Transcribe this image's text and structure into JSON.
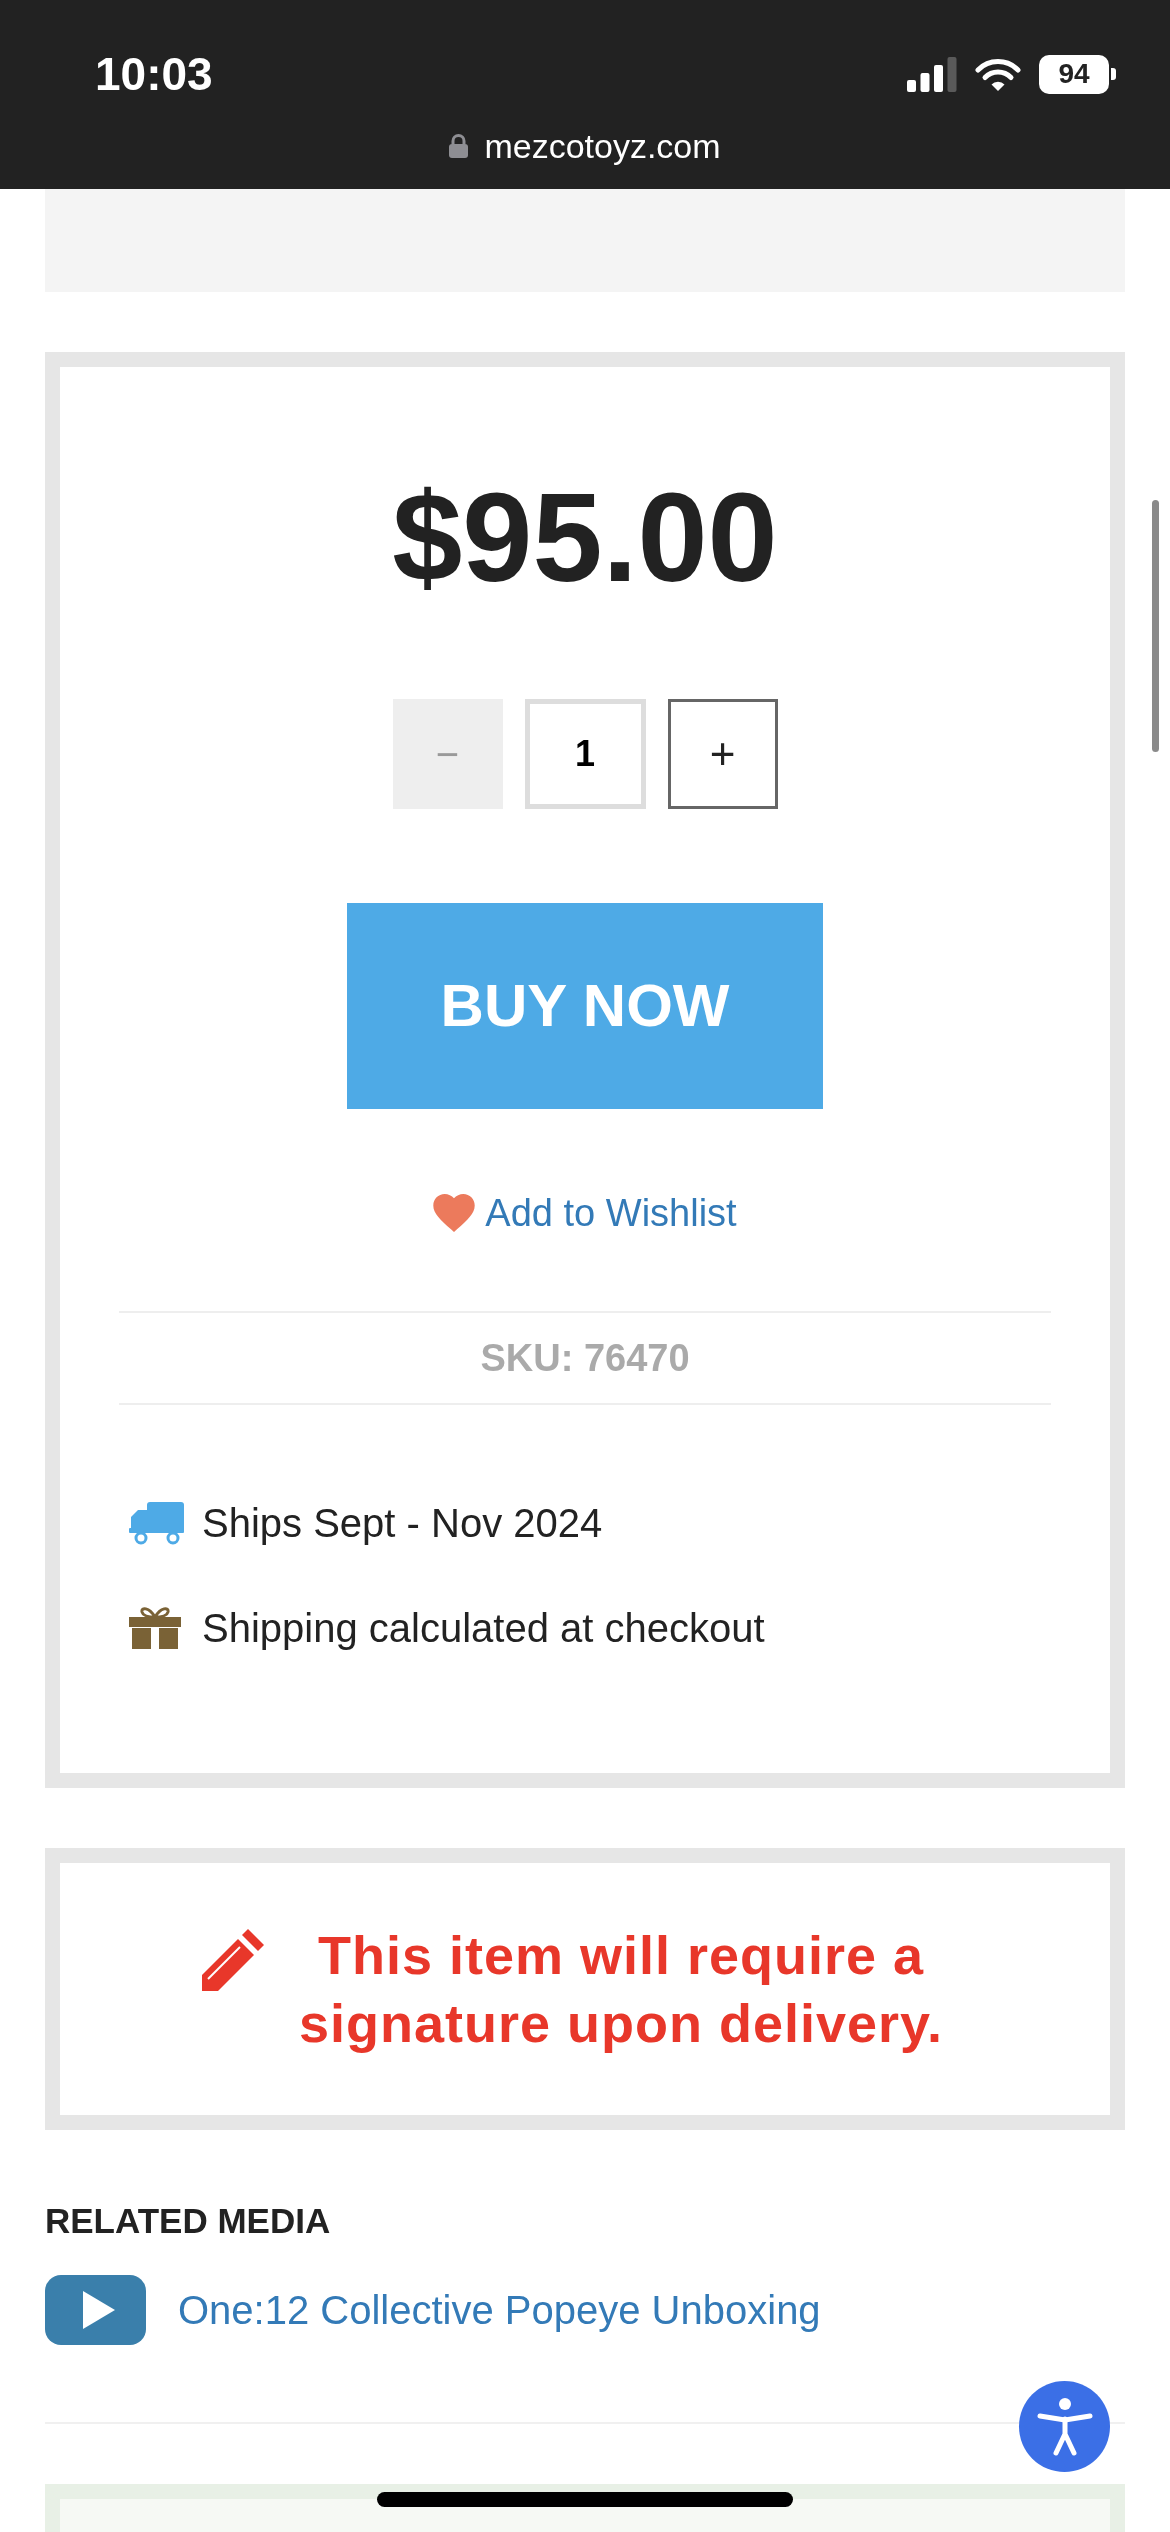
{
  "status_bar": {
    "time": "10:03",
    "battery": "94",
    "url": "mezcotoyz.com"
  },
  "product": {
    "price": "$95.00",
    "quantity": {
      "decrement": {
        "label": "−",
        "disabled": true
      },
      "value": "1",
      "increment": {
        "label": "+",
        "disabled": false
      }
    },
    "buy_button": "BUY NOW",
    "wishlist": "Add to Wishlist",
    "sku": "SKU: 76470",
    "shipping": [
      {
        "kind": "truck",
        "text": "Ships Sept - Nov 2024"
      },
      {
        "kind": "gift",
        "text": "Shipping calculated at checkout"
      }
    ]
  },
  "notice": {
    "text": "This item will require a signature upon delivery."
  },
  "related_media": {
    "title": "RELATED MEDIA",
    "items": [
      {
        "title": "One:12 Collective Popeye Unboxing"
      }
    ]
  }
}
